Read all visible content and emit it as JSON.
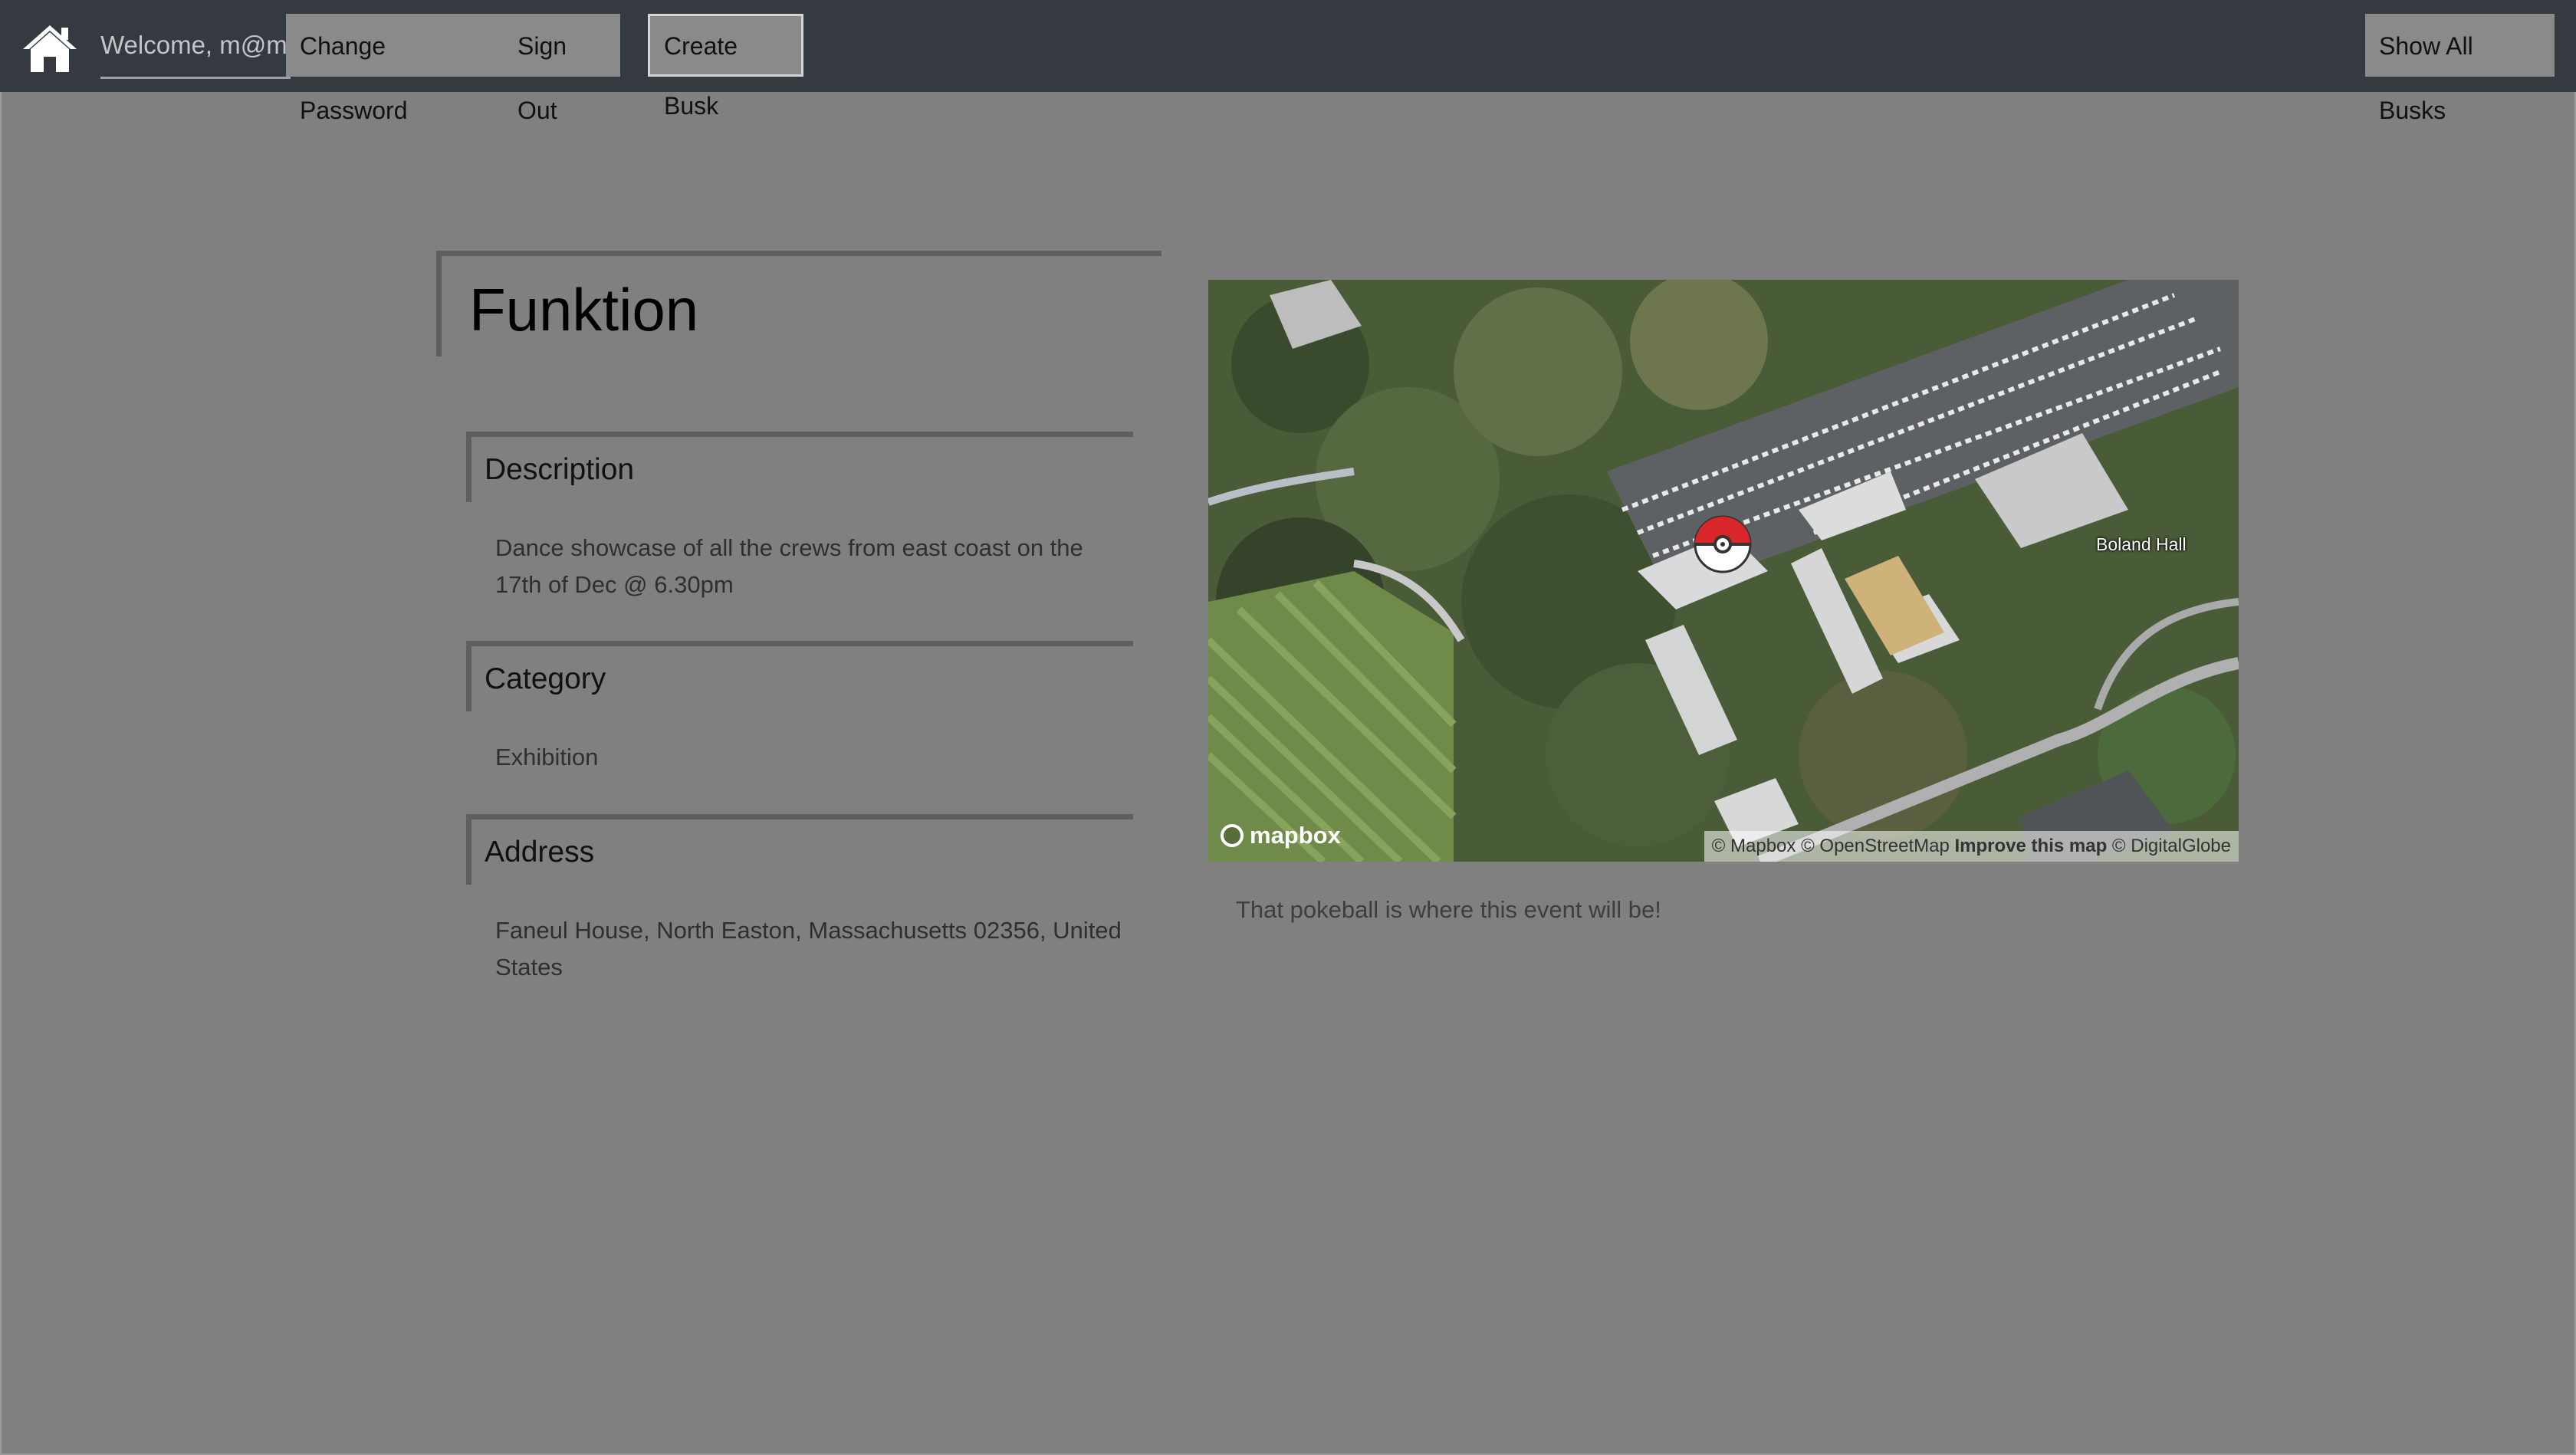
{
  "nav": {
    "welcome": "Welcome, m@m",
    "change_password": "Change Password",
    "sign_out": "Sign Out",
    "create_busk": "Create Busk",
    "show_all": "Show All Busks"
  },
  "event": {
    "title": "Funktion",
    "sections": [
      {
        "heading": "Description",
        "body": "Dance showcase of all the crews from east coast on the 17th of Dec @ 6.30pm"
      },
      {
        "heading": "Category",
        "body": "Exhibition"
      },
      {
        "heading": "Address",
        "body": "Faneul House, North Easton, Massachusetts 02356, United States"
      }
    ]
  },
  "map": {
    "logo": "mapbox",
    "attribution_1": "© Mapbox",
    "attribution_2": "© OpenStreetMap",
    "attribution_improve": "Improve this map",
    "attribution_3": "© DigitalGlobe",
    "poi_label": "Boland Hall",
    "caption": "That pokeball is where this event will be!"
  },
  "colors": {
    "navbar": "#343a40",
    "page_bg": "#808080",
    "pin_red": "#d8262a"
  },
  "icons": [
    "home-icon",
    "pokeball-pin-icon",
    "mapbox-logo-icon"
  ]
}
